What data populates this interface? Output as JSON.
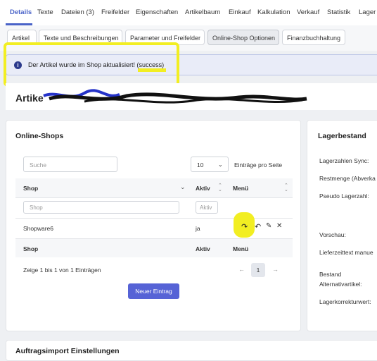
{
  "top_tabs": [
    "Details",
    "Texte",
    "Dateien (3)",
    "Freifelder",
    "Eigenschaften",
    "Artikelbaum",
    "Einkauf",
    "Kalkulation",
    "Verkauf",
    "Statistik",
    "Lager"
  ],
  "sub_tabs": [
    "Artikel",
    "Texte und Beschreibungen",
    "Parameter und Freifelder",
    "Online-Shop Optionen",
    "Finanzbuchhaltung"
  ],
  "alert": {
    "message": "Der Artikel wurde im Shop aktualisiert! (success)",
    "icon": "info-icon"
  },
  "article_title_prefix": "Artike",
  "online_shops": {
    "title": "Online-Shops",
    "search_placeholder": "Suche",
    "page_size": "10",
    "per_page_label": "Einträge pro Seite",
    "columns": [
      "Shop",
      "Aktiv",
      "Menü"
    ],
    "filter_shop_placeholder": "Shop",
    "filter_active_placeholder": "Aktiv",
    "rows": [
      {
        "shop": "Shopware6",
        "aktiv": "ja"
      }
    ],
    "footer_columns": [
      "Shop",
      "Aktiv",
      "Menü"
    ],
    "info": "Zeige 1 bis 1 von 1 Einträgen",
    "prev": "←",
    "page": "1",
    "next": "→",
    "new_button": "Neuer Eintrag"
  },
  "lagerbestand": {
    "title": "Lagerbestand",
    "labels": [
      "Lagerzahlen Sync:",
      "Restmenge (Abverka",
      "Pseudo Lagerzahl:",
      "Vorschau:",
      "Lieferzeittext manue",
      "Bestand",
      "Alternativartikel:",
      "Lagerkorrekturwert:"
    ]
  },
  "bottom_section_title": "Auftragsimport Einstellungen",
  "colors": {
    "accent": "#4a63c8",
    "primary_button": "#5663d6",
    "highlight": "#f2ee22"
  }
}
